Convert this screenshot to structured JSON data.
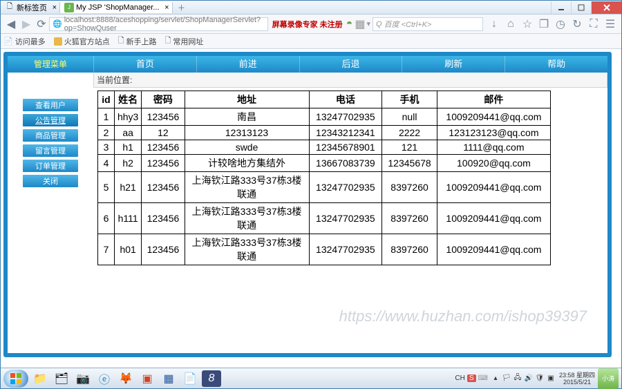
{
  "window": {
    "tabs": [
      {
        "title": "新标签页"
      },
      {
        "title": "My JSP 'ShopManager...",
        "active": true
      }
    ]
  },
  "addressbar": {
    "url": "localhost:8888/aceshopping/servlet/ShopManagerServlet?op=ShowQuser",
    "recorder_text": "屏幕录像专家 未注册",
    "search_placeholder": "百度 <Ctrl+K>"
  },
  "bookmarks": {
    "label": "访问最多",
    "items": [
      "火狐官方站点",
      "新手上路",
      "常用网址"
    ]
  },
  "topnav": [
    "首页",
    "前进",
    "后退",
    "刷新",
    "帮助"
  ],
  "sidemenu": {
    "title": "管理菜单",
    "items": [
      {
        "label": "查看用户"
      },
      {
        "label": "公告管理",
        "active": true
      },
      {
        "label": "商品管理"
      },
      {
        "label": "留言管理"
      },
      {
        "label": "订单管理"
      },
      {
        "label": "关闭"
      }
    ]
  },
  "content": {
    "crumb": "当前位置:",
    "headers": {
      "id": "id",
      "name": "姓名",
      "pwd": "密码",
      "addr": "地址",
      "tel": "电话",
      "mobile": "手机",
      "email": "邮件"
    },
    "rows": [
      {
        "id": "1",
        "name": "hhy3",
        "pwd": "123456",
        "addr": "南昌",
        "tel": "13247702935",
        "mobile": "null",
        "email": "1009209441@qq.com"
      },
      {
        "id": "2",
        "name": "aa",
        "pwd": "12",
        "addr": "12313123",
        "tel": "12343212341",
        "mobile": "2222",
        "email": "123123123@qq.com"
      },
      {
        "id": "3",
        "name": "h1",
        "pwd": "123456",
        "addr": "swde",
        "tel": "12345678901",
        "mobile": "121",
        "email": "1111@qq.com"
      },
      {
        "id": "4",
        "name": "h2",
        "pwd": "123456",
        "addr": "计较啥地方集结外",
        "tel": "13667083739",
        "mobile": "12345678",
        "email": "100920@qq.com"
      },
      {
        "id": "5",
        "name": "h21",
        "pwd": "123456",
        "addr": "上海钦江路333号37栋3楼联通",
        "tel": "13247702935",
        "mobile": "8397260",
        "email": "1009209441@qq.com"
      },
      {
        "id": "6",
        "name": "h111",
        "pwd": "123456",
        "addr": "上海钦江路333号37栋3楼联通",
        "tel": "13247702935",
        "mobile": "8397260",
        "email": "1009209441@qq.com"
      },
      {
        "id": "7",
        "name": "h01",
        "pwd": "123456",
        "addr": "上海钦江路333号37栋3楼联通",
        "tel": "13247702935",
        "mobile": "8397260",
        "email": "1009209441@qq.com"
      }
    ]
  },
  "watermark": "https://www.huzhan.com/ishop39397",
  "tray": {
    "input": "CH",
    "time": "23:58 星期四",
    "date": "2015/5/21",
    "user": "小涛"
  }
}
